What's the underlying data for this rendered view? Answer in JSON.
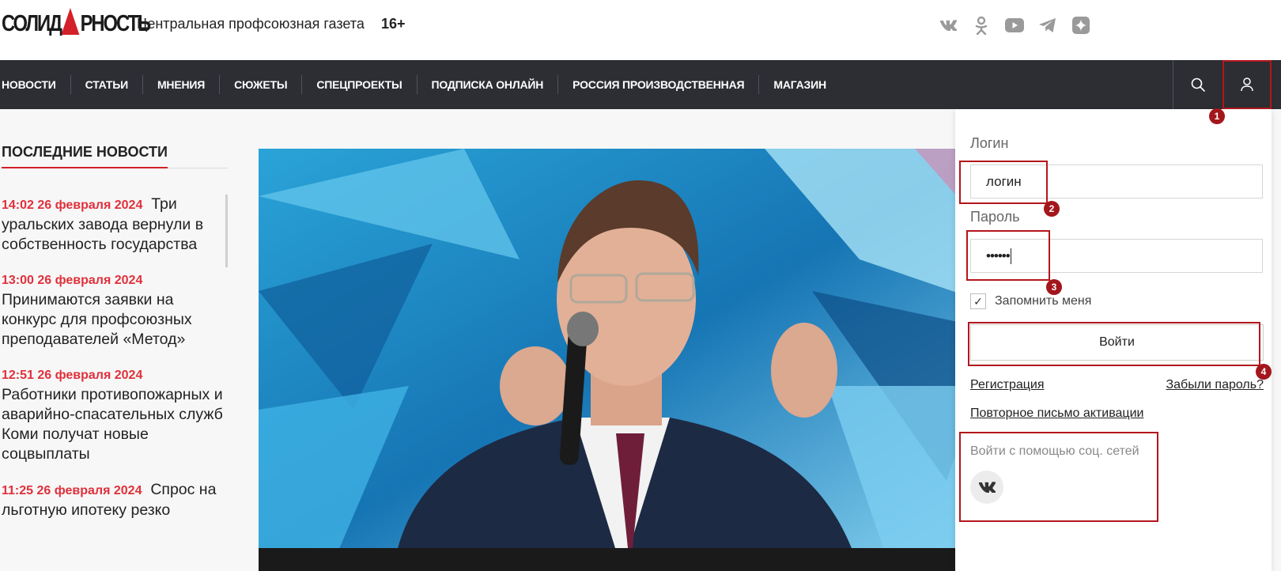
{
  "header": {
    "logo_text": "СОЛИДАРНОСТЬ",
    "logo_left": "СОЛИД",
    "logo_right": "РНОСТЬ",
    "tagline": "Центральная профсоюзная газета",
    "age_rating": "16+",
    "social_icons": [
      "vk-icon",
      "odnoklassniki-icon",
      "youtube-icon",
      "telegram-icon",
      "zen-icon"
    ]
  },
  "nav": {
    "items": [
      "НОВОСТИ",
      "СТАТЬИ",
      "МНЕНИЯ",
      "СЮЖЕТЫ",
      "СПЕЦПРОЕКТЫ",
      "ПОДПИСКА ОНЛАЙН",
      "РОССИЯ ПРОИЗВОДСТВЕННАЯ",
      "МАГАЗИН"
    ],
    "search_icon": "search-icon",
    "user_icon": "user-icon",
    "background": "#2c2e33"
  },
  "latest_news": {
    "title": "ПОСЛЕДНИЕ НОВОСТИ",
    "items": [
      {
        "time": "14:02 26 февраля 2024",
        "title": "Три уральских завода вернули в собственность государства"
      },
      {
        "time": "13:00 26 февраля 2024",
        "title": "Принимаются заявки на конкурс для профсоюзных преподавателей «Метод»"
      },
      {
        "time": "12:51 26 февраля 2024",
        "title": "Работники противопожарных и аварийно-спасательных служб Коми получат новые соцвыплаты"
      },
      {
        "time": "11:25 26 февраля 2024",
        "title": "Спрос на льготную ипотеку резко"
      }
    ]
  },
  "login_form": {
    "login_label": "Логин",
    "login_value": "логин",
    "password_label": "Пароль",
    "password_value": "••••••",
    "remember_label": "Запомнить меня",
    "remember_checked": true,
    "submit_label": "Войти",
    "register_link": "Регистрация",
    "forgot_link": "Забыли пароль?",
    "resend_link": "Повторное письмо активации",
    "social_login_label": "Войти с помощью соц. сетей",
    "social_login_icon": "vk-icon"
  },
  "annotations": [
    "1",
    "2",
    "3",
    "4"
  ],
  "colors": {
    "accent": "#d32029",
    "news_time": "#e0303b",
    "annotation": "#b3161c"
  }
}
